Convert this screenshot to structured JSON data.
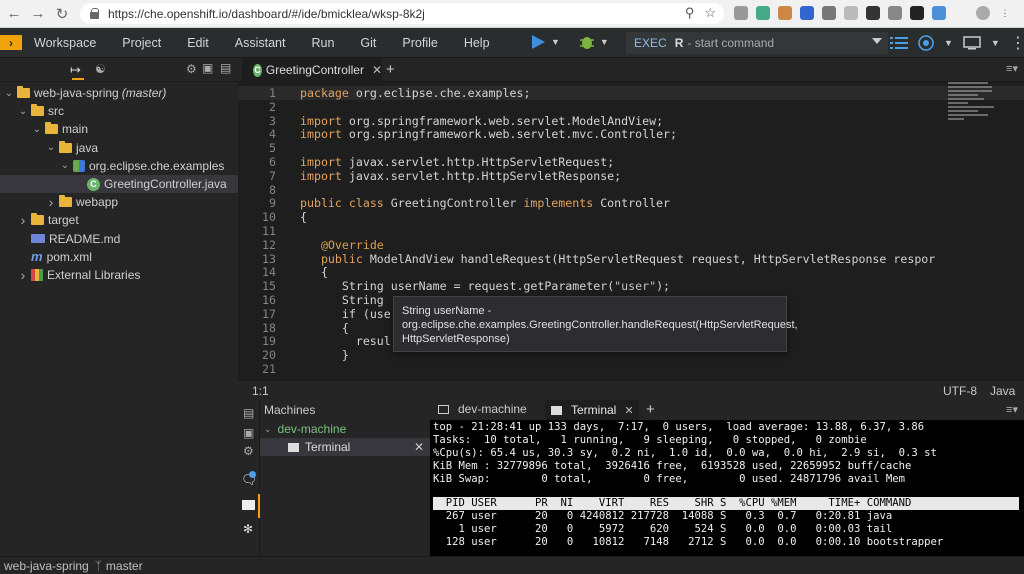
{
  "browser": {
    "url": "https://che.openshift.io/dashboard/#/ide/bmicklea/wksp-8k2j"
  },
  "menubar": {
    "items": [
      "Workspace",
      "Project",
      "Edit",
      "Assistant",
      "Run",
      "Git",
      "Profile",
      "Help"
    ],
    "exec_label": "EXEC",
    "exec_prefix": "R",
    "exec_placeholder": "- start command"
  },
  "explorer": {
    "tree": [
      {
        "label": "web-java-spring",
        "branch": "(master)",
        "icon": "project-icon",
        "level": 0,
        "chevron": "open"
      },
      {
        "label": "src",
        "icon": "folder-icon",
        "level": 1,
        "chevron": "open"
      },
      {
        "label": "main",
        "icon": "folder-icon",
        "level": 2,
        "chevron": "open"
      },
      {
        "label": "java",
        "icon": "folder-icon",
        "level": 3,
        "chevron": "open"
      },
      {
        "label": "org.eclipse.che.examples",
        "icon": "package-icon",
        "level": 4,
        "chevron": "open"
      },
      {
        "label": "GreetingController.java",
        "icon": "class-icon",
        "level": 5,
        "chevron": "none",
        "selected": true
      },
      {
        "label": "webapp",
        "icon": "folder-icon",
        "level": 3,
        "chevron": "closed"
      },
      {
        "label": "target",
        "icon": "folder-icon",
        "level": 1,
        "chevron": "closed"
      },
      {
        "label": "README.md",
        "icon": "markdown-icon",
        "level": 1,
        "chevron": "none"
      },
      {
        "label": "pom.xml",
        "icon": "maven-icon",
        "level": 1,
        "chevron": "none"
      },
      {
        "label": "External Libraries",
        "icon": "library-icon",
        "level": 1,
        "chevron": "closed"
      }
    ]
  },
  "editor": {
    "tab_label": "GreetingController",
    "lines": [
      "package org.eclipse.che.examples;",
      "",
      "import org.springframework.web.servlet.ModelAndView;",
      "import org.springframework.web.servlet.mvc.Controller;",
      "",
      "import javax.servlet.http.HttpServletRequest;",
      "import javax.servlet.http.HttpServletResponse;",
      "",
      "public class GreetingController implements Controller",
      "{",
      "",
      "   @Override",
      "   public ModelAndView handleRequest(HttpServletRequest request, HttpServletResponse respor",
      "   {",
      "      String userName = request.getParameter(\"user\");",
      "      String",
      "      if (use",
      "      {",
      "        resul",
      "      }",
      ""
    ],
    "tooltip": "String userName - org.eclipse.che.examples.GreetingController.handleRequest(HttpServletRequest, HttpServletResponse)",
    "cursor_position": "1:1",
    "encoding": "UTF-8",
    "language": "Java"
  },
  "machines": {
    "title": "Machines",
    "machine": "dev-machine",
    "terminal_item": "Terminal"
  },
  "terminal": {
    "tabs": [
      "dev-machine",
      "Terminal"
    ],
    "lines": [
      "top - 21:28:41 up 133 days,  7:17,  0 users,  load average: 13.88, 6.37, 3.86",
      "Tasks:  10 total,   1 running,   9 sleeping,   0 stopped,   0 zombie",
      "%Cpu(s): 65.4 us, 30.3 sy,  0.2 ni,  1.0 id,  0.0 wa,  0.0 hi,  2.9 si,  0.3 st",
      "KiB Mem : 32779896 total,  3926416 free,  6193528 used, 22659952 buff/cache",
      "KiB Swap:        0 total,        0 free,        0 used. 24871796 avail Mem"
    ],
    "header": "  PID USER      PR  NI    VIRT    RES    SHR S  %CPU %MEM     TIME+ COMMAND",
    "processes": [
      "  267 user      20   0 4240812 217728  14088 S   0.3  0.7   0:20.81 java",
      "    1 user      20   0    5972    620    524 S   0.0  0.0   0:00.03 tail",
      "  128 user      20   0   10812   7148   2712 S   0.0  0.0   0:00.10 bootstrapper"
    ]
  },
  "statusbar": {
    "project": "web-java-spring",
    "branch": "master"
  }
}
